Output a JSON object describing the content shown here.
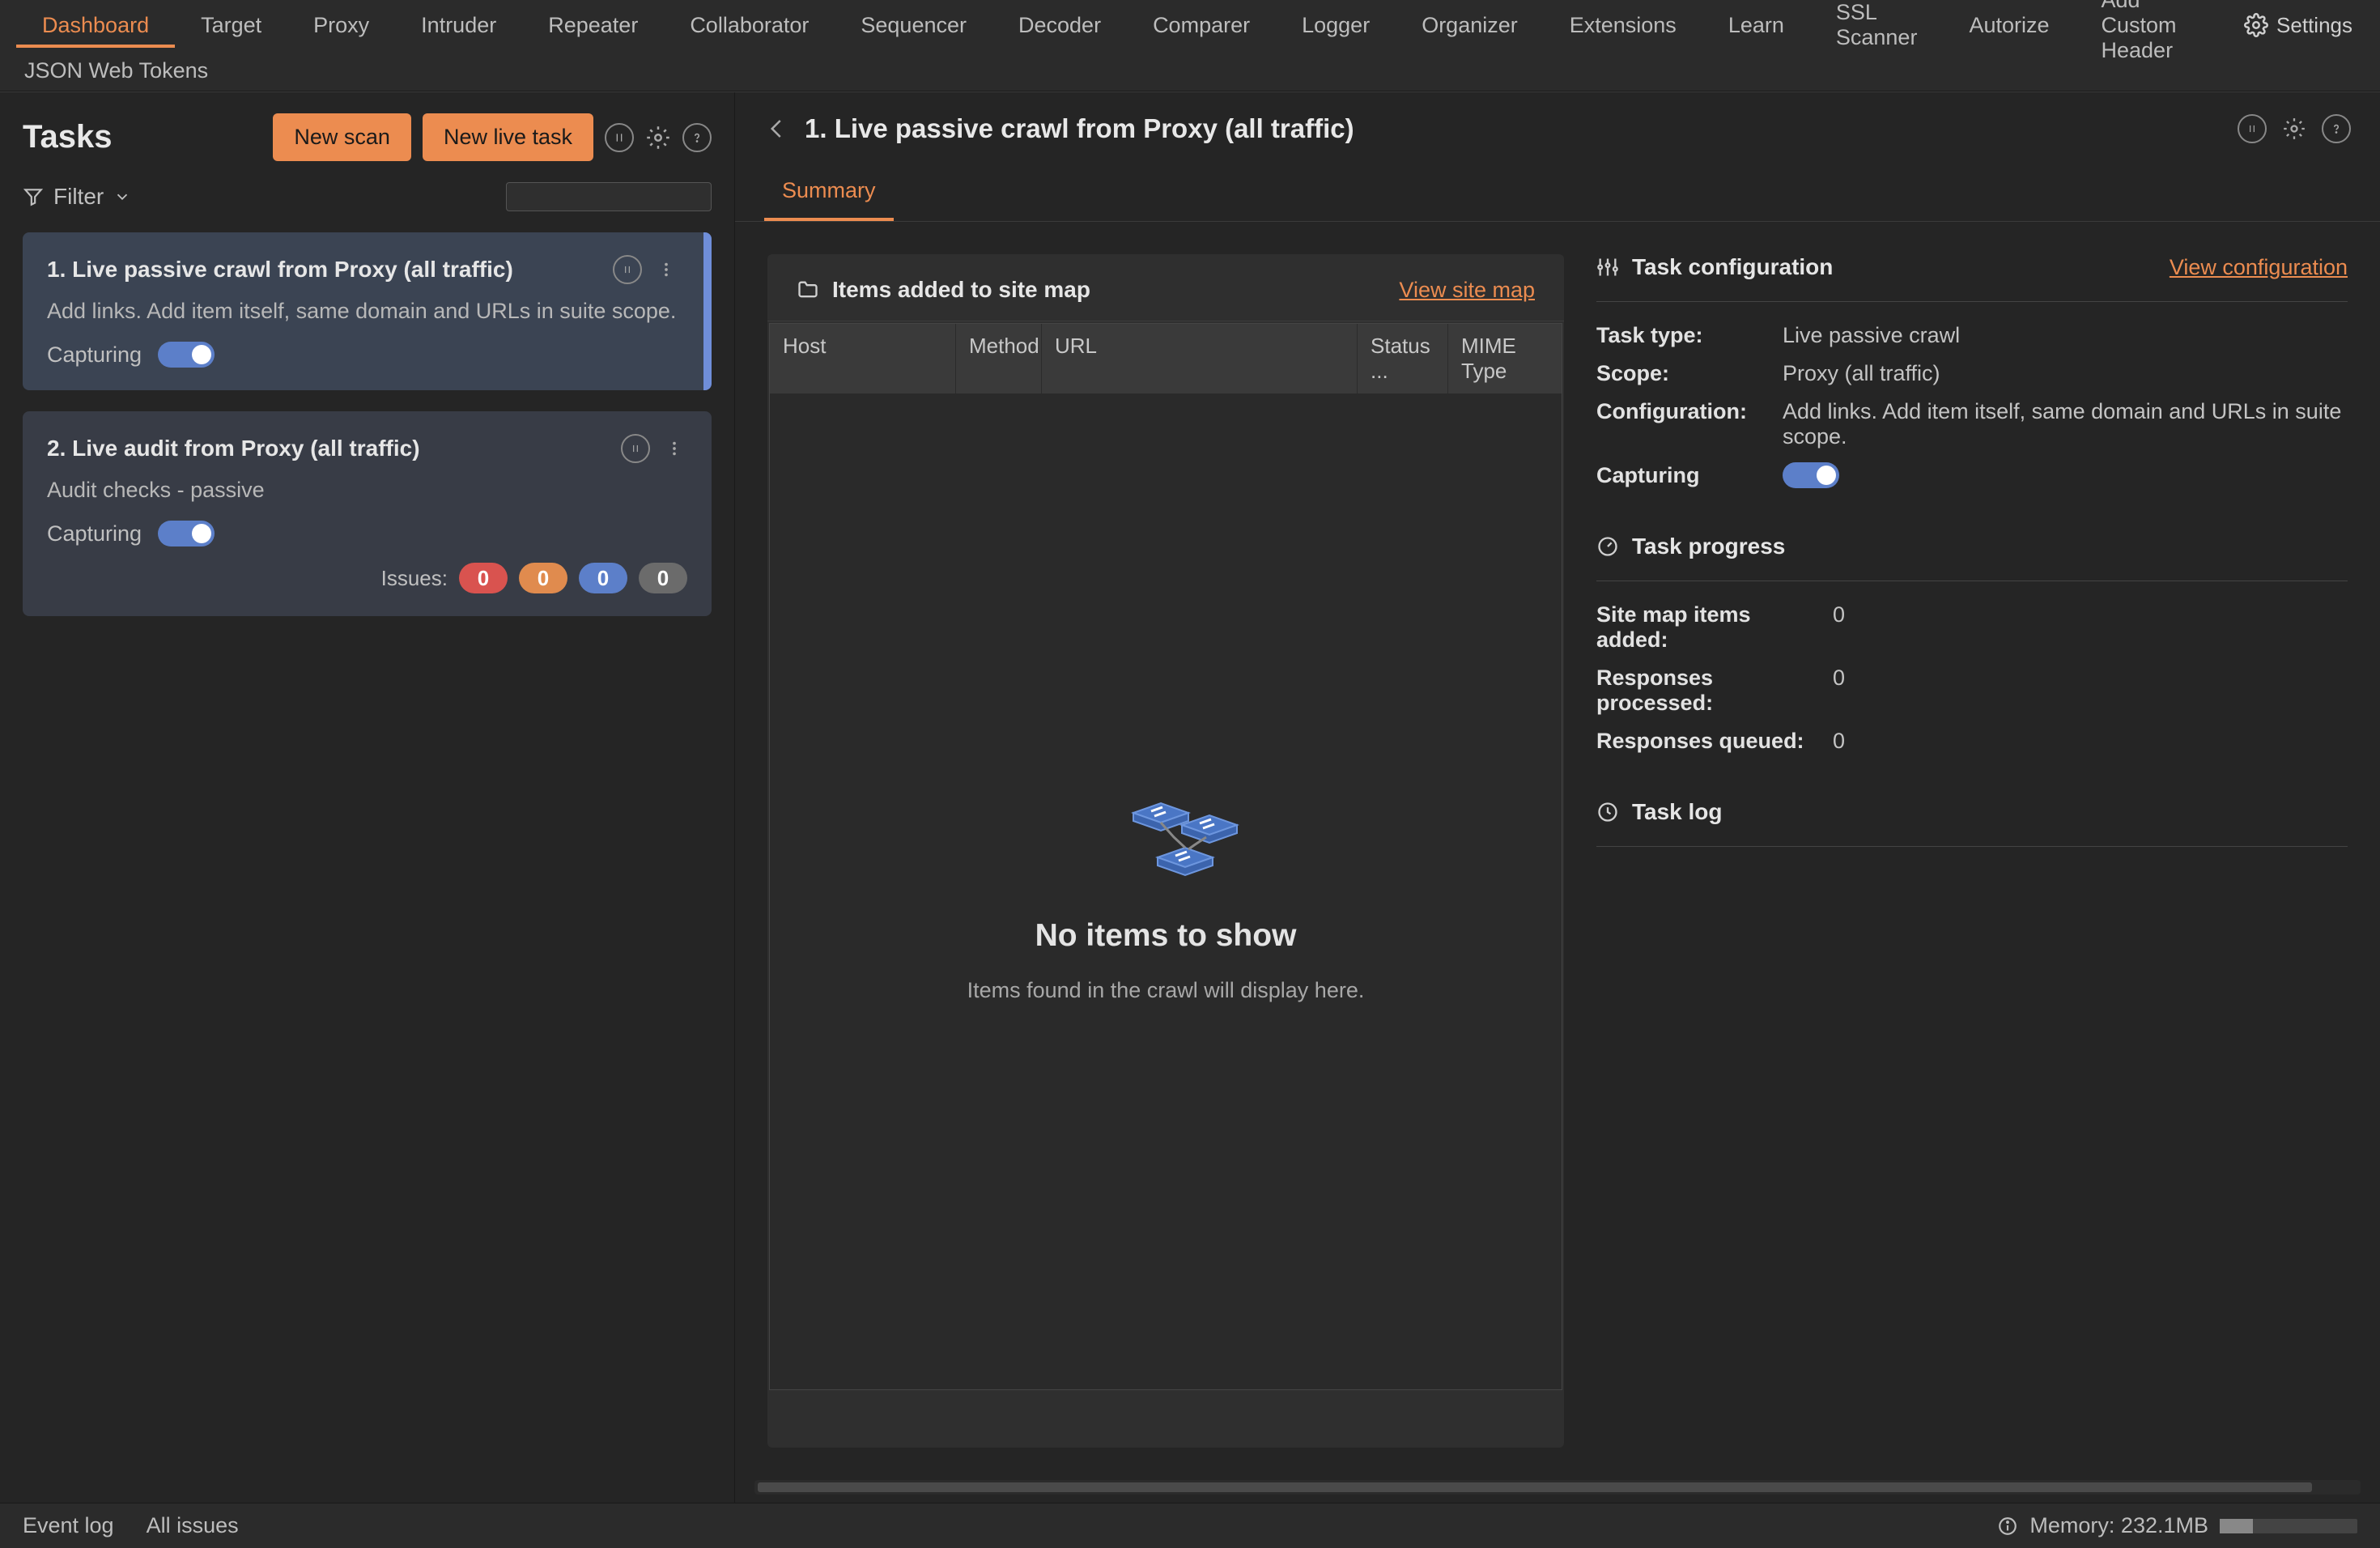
{
  "top_tabs_row1": [
    "Dashboard",
    "Target",
    "Proxy",
    "Intruder",
    "Repeater",
    "Collaborator",
    "Sequencer",
    "Decoder",
    "Comparer",
    "Logger",
    "Organizer",
    "Extensions",
    "Learn",
    "SSL Scanner",
    "Autorize",
    "Add Custom Header"
  ],
  "top_tabs_row1_active": 0,
  "top_tabs_row2": [
    "JSON Web Tokens"
  ],
  "settings_label": "Settings",
  "tasks": {
    "title": "Tasks",
    "new_scan_label": "New scan",
    "new_live_task_label": "New live task",
    "filter_label": "Filter",
    "search_value": "",
    "items": [
      {
        "title": "1. Live passive crawl from Proxy (all traffic)",
        "desc": "Add links. Add item itself, same domain and URLs in suite scope.",
        "capturing_label": "Capturing",
        "active": true
      },
      {
        "title": "2. Live audit from Proxy (all traffic)",
        "desc": "Audit checks - passive",
        "capturing_label": "Capturing",
        "active": false,
        "issues_label": "Issues:",
        "issues": {
          "high": "0",
          "medium": "0",
          "low": "0",
          "info": "0"
        }
      }
    ]
  },
  "detail": {
    "title": "1. Live passive crawl from Proxy (all traffic)",
    "subtabs": [
      "Summary"
    ],
    "subtab_active": 0,
    "sitemap": {
      "title": "Items added to site map",
      "view_link": "View site map",
      "columns": {
        "host": "Host",
        "method": "Method",
        "url": "URL",
        "status": "Status ...",
        "mime": "MIME Type"
      },
      "empty_title": "No items to show",
      "empty_sub": "Items found in the crawl will display here."
    },
    "config": {
      "title": "Task configuration",
      "view_link": "View configuration",
      "rows": {
        "task_type": {
          "k": "Task type:",
          "v": "Live passive crawl"
        },
        "scope": {
          "k": "Scope:",
          "v": "Proxy (all traffic)"
        },
        "configuration": {
          "k": "Configuration:",
          "v": "Add links. Add item itself, same domain and URLs in suite scope."
        }
      },
      "capturing_label": "Capturing"
    },
    "progress": {
      "title": "Task progress",
      "rows": {
        "added": {
          "k": "Site map items added:",
          "v": "0"
        },
        "processed": {
          "k": "Responses processed:",
          "v": "0"
        },
        "queued": {
          "k": "Responses queued:",
          "v": "0"
        }
      }
    },
    "log": {
      "title": "Task log"
    }
  },
  "footer": {
    "event_log": "Event log",
    "all_issues": "All issues",
    "memory_label": "Memory: 232.1MB"
  }
}
